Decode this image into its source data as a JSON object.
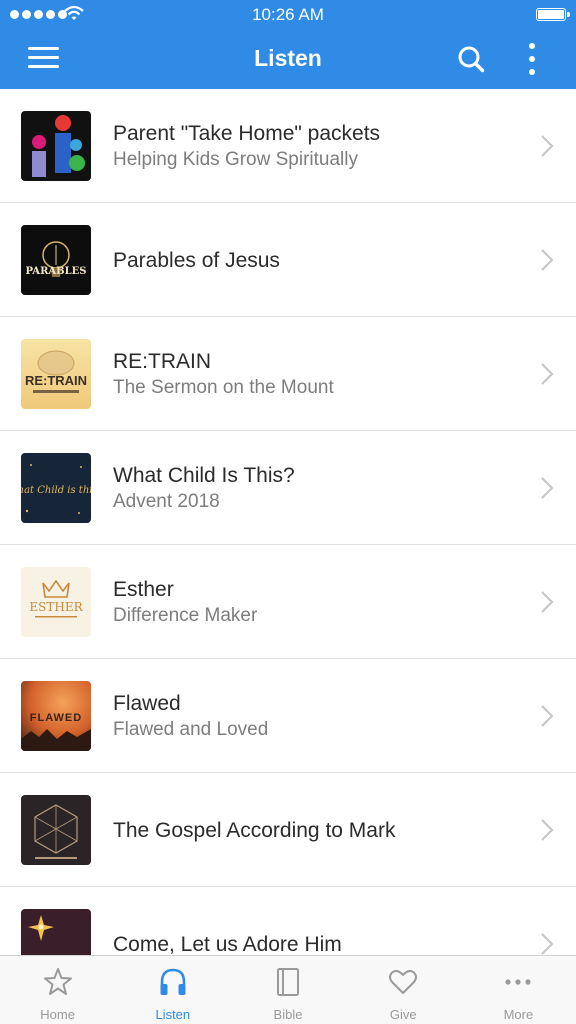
{
  "status_bar": {
    "time": "10:26 AM"
  },
  "header": {
    "title": "Listen"
  },
  "items": [
    {
      "title": "Parent \"Take Home\" packets",
      "subtitle": "Helping Kids Grow Spiritually"
    },
    {
      "title": "Parables of Jesus",
      "subtitle": "",
      "thumb_text": "PARABLES"
    },
    {
      "title": "RE:TRAIN",
      "subtitle": "The Sermon on the Mount",
      "thumb_text": "RE:TRAIN"
    },
    {
      "title": "What Child Is This?",
      "subtitle": "Advent 2018",
      "thumb_text": "what Child is this?"
    },
    {
      "title": "Esther",
      "subtitle": "Difference Maker",
      "thumb_text": "ESTHER"
    },
    {
      "title": "Flawed",
      "subtitle": "Flawed and Loved",
      "thumb_text": "FLAWED"
    },
    {
      "title": "The Gospel According to Mark",
      "subtitle": ""
    },
    {
      "title": "Come, Let us Adore Him",
      "subtitle": ""
    }
  ],
  "tabs": [
    {
      "label": "Home",
      "icon": "star-icon"
    },
    {
      "label": "Listen",
      "icon": "headphones-icon",
      "active": true
    },
    {
      "label": "Bible",
      "icon": "book-icon"
    },
    {
      "label": "Give",
      "icon": "heart-icon"
    },
    {
      "label": "More",
      "icon": "more-dots-icon"
    }
  ],
  "colors": {
    "brand": "#2f8be6",
    "tab_inactive": "#9a9a9a"
  }
}
